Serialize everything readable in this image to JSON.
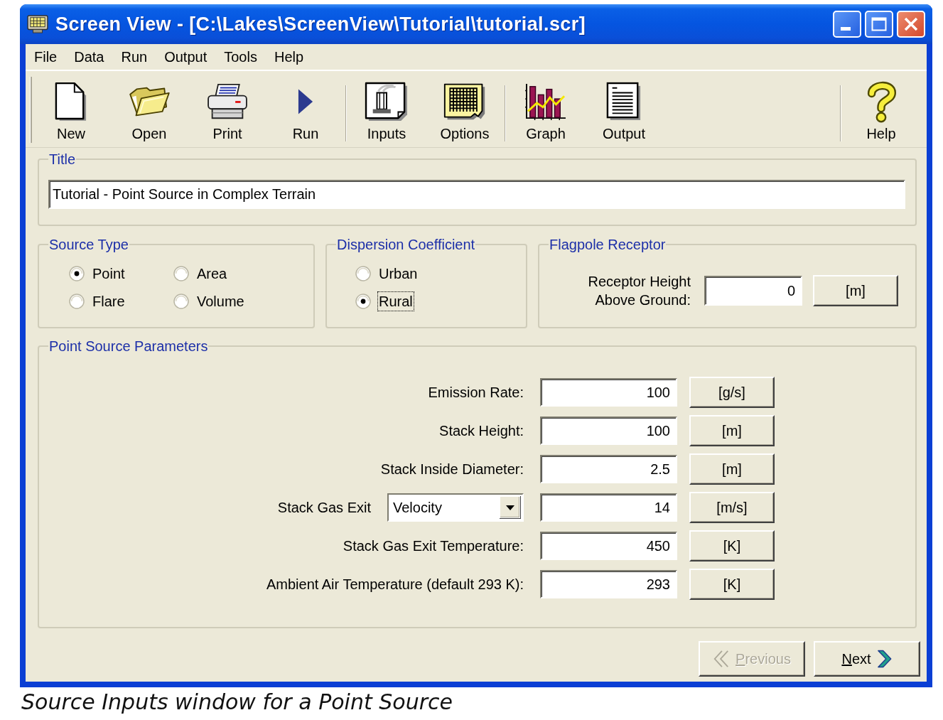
{
  "window": {
    "title": "Screen View - [C:\\Lakes\\ScreenView\\Tutorial\\tutorial.scr]"
  },
  "menu": [
    "File",
    "Data",
    "Run",
    "Output",
    "Tools",
    "Help"
  ],
  "toolbar": {
    "groups": [
      [
        {
          "kind": "new",
          "label": "New"
        },
        {
          "kind": "open",
          "label": "Open"
        },
        {
          "kind": "print",
          "label": "Print"
        },
        {
          "kind": "run",
          "label": "Run"
        }
      ],
      [
        {
          "kind": "inputs",
          "label": "Inputs"
        },
        {
          "kind": "options",
          "label": "Options"
        }
      ],
      [
        {
          "kind": "graph",
          "label": "Graph"
        },
        {
          "kind": "output",
          "label": "Output"
        }
      ],
      [
        {
          "kind": "help",
          "label": "Help"
        }
      ]
    ]
  },
  "title_group": {
    "legend": "Title",
    "value": "Tutorial - Point Source in Complex Terrain"
  },
  "source_type": {
    "legend": "Source Type",
    "options": [
      {
        "label": "Point",
        "selected": true
      },
      {
        "label": "Area",
        "selected": false
      },
      {
        "label": "Flare",
        "selected": false
      },
      {
        "label": "Volume",
        "selected": false
      }
    ]
  },
  "dispersion_coefficient": {
    "legend": "Dispersion Coefficient",
    "options": [
      {
        "label": "Urban",
        "selected": false,
        "focused": false
      },
      {
        "label": "Rural",
        "selected": true,
        "focused": true
      }
    ]
  },
  "flagpole_receptor": {
    "legend": "Flagpole Receptor",
    "label": "Receptor Height Above Ground:",
    "value": "0",
    "unit": "[m]"
  },
  "point_source_parameters": {
    "legend": "Point Source Parameters",
    "rows": [
      {
        "kind": "field",
        "label": "Emission Rate:",
        "value": "100",
        "unit": "[g/s]"
      },
      {
        "kind": "field",
        "label": "Stack Height:",
        "value": "100",
        "unit": "[m]"
      },
      {
        "kind": "field",
        "label": "Stack Inside Diameter:",
        "value": "2.5",
        "unit": "[m]"
      },
      {
        "kind": "dropdown",
        "label": "Stack Gas Exit",
        "choice": "Velocity",
        "value": "14",
        "unit": "[m/s]"
      },
      {
        "kind": "field",
        "label": "Stack Gas Exit Temperature:",
        "value": "450",
        "unit": "[K]"
      },
      {
        "kind": "field",
        "label": "Ambient Air Temperature (default 293 K):",
        "value": "293",
        "unit": "[K]"
      }
    ]
  },
  "buttons": [
    {
      "kind": "previous",
      "label": "Previous",
      "disabled": true
    },
    {
      "kind": "next",
      "label": "Next",
      "disabled": false
    }
  ],
  "caption": "Source Inputs window for a Point Source"
}
